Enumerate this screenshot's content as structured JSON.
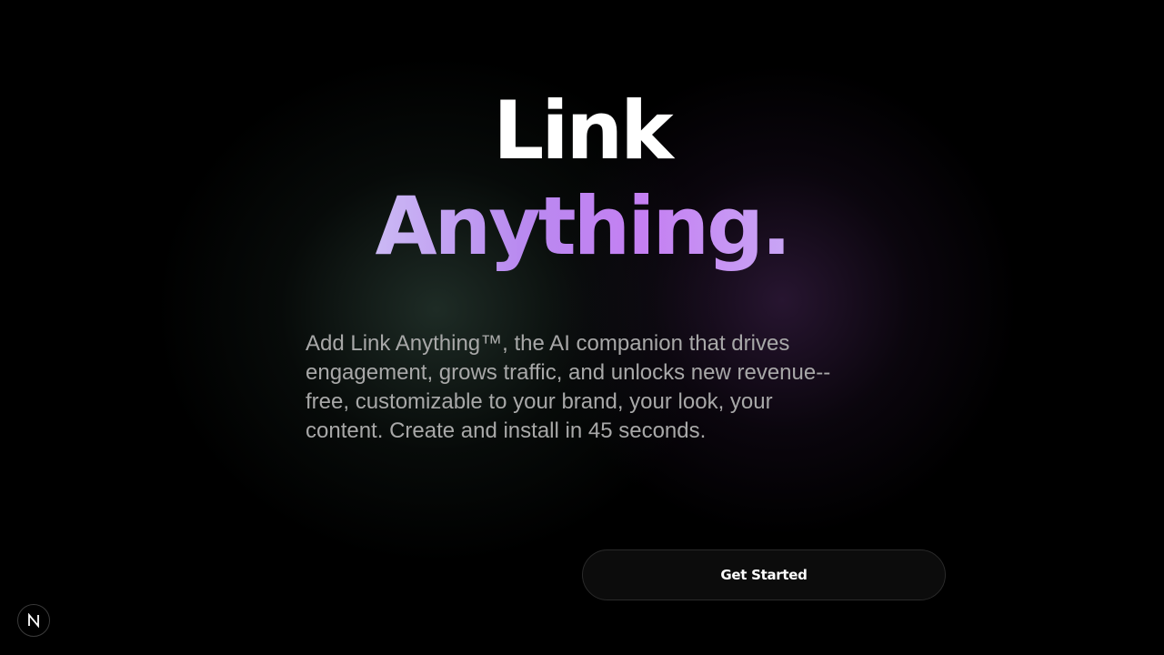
{
  "hero": {
    "headline_line1": "Link",
    "headline_line2": "Anything.",
    "description": "Add Link Anything™, the AI companion that drives engagement, grows traffic, and unlocks new revenue-- free, customizable to your brand, your look, your content. Create and install in 45 seconds."
  },
  "cta": {
    "label": "Get Started"
  },
  "dev_badge": {
    "icon": "n-logo-icon"
  },
  "colors": {
    "background": "#000000",
    "headline_white": "#ffffff",
    "gradient_start": "#cbb9f4",
    "gradient_end": "#c47ff2",
    "body_text": "#a8a8a8",
    "button_bg": "#0c0c0c"
  }
}
